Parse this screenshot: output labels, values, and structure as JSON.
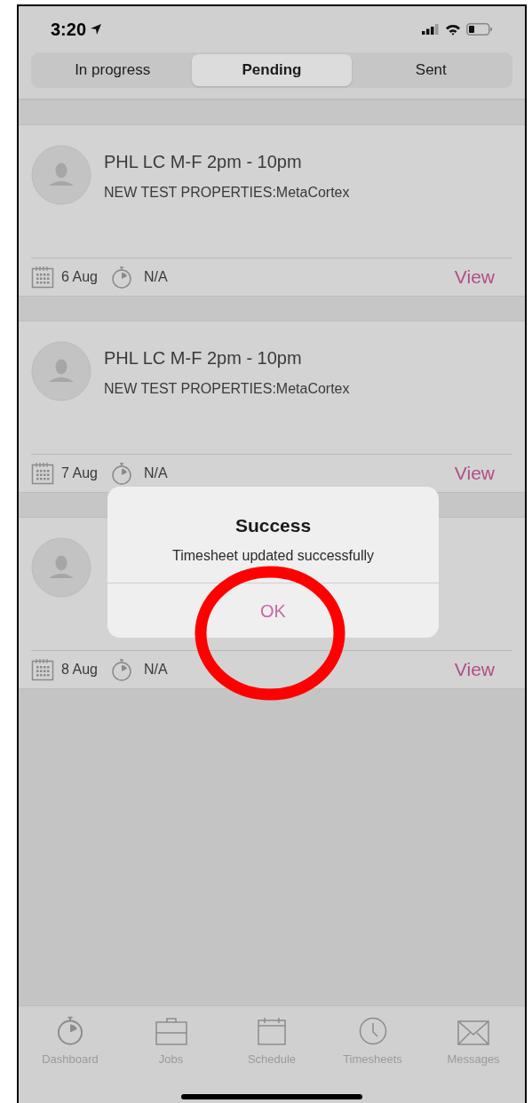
{
  "status_bar": {
    "time": "3:20"
  },
  "tabs": [
    {
      "label": "In progress",
      "selected": false
    },
    {
      "label": "Pending",
      "selected": true
    },
    {
      "label": "Sent",
      "selected": false
    }
  ],
  "jobs": [
    {
      "title": "PHL LC M-F 2pm - 10pm",
      "subtitle": "NEW TEST PROPERTIES:MetaCortex",
      "date": "6 Aug",
      "duration": "N/A",
      "action": "View"
    },
    {
      "title": "PHL LC M-F 2pm - 10pm",
      "subtitle": "NEW TEST PROPERTIES:MetaCortex",
      "date": "7 Aug",
      "duration": "N/A",
      "action": "View"
    },
    {
      "date": "8 Aug",
      "duration": "N/A",
      "action": "View"
    }
  ],
  "dialog": {
    "title": "Success",
    "message": "Timesheet updated successfully",
    "button": "OK"
  },
  "bottom_nav": [
    {
      "kind": "dashboard",
      "label": "Dashboard"
    },
    {
      "kind": "jobs",
      "label": "Jobs"
    },
    {
      "kind": "schedule",
      "label": "Schedule"
    },
    {
      "kind": "timesheets",
      "label": "Timesheets"
    },
    {
      "kind": "messages",
      "label": "Messages"
    }
  ]
}
